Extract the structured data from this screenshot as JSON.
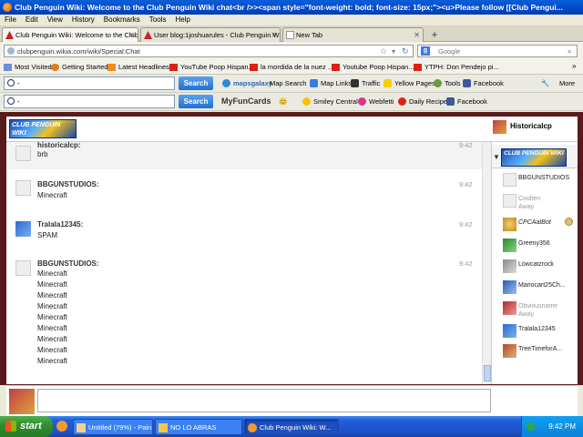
{
  "window": {
    "title": "Club Penguin Wiki: Welcome to the Club Penguin Wiki chat<br />><span style=\"font-weight: bold; font-size: 15px;\"><u>Please follow [[Club Pengui..."
  },
  "menu": [
    "File",
    "Edit",
    "View",
    "History",
    "Bookmarks",
    "Tools",
    "Help"
  ],
  "tabs": [
    {
      "label": "Club Penguin Wiki: Welcome to the Club ...",
      "active": true
    },
    {
      "label": "User blog:1joshuarules - Club Penguin Wi...",
      "active": false
    },
    {
      "label": "New Tab",
      "active": false
    }
  ],
  "nav": {
    "url": "clubpenguin.wikia.com/wiki/Special:Chat",
    "search_placeholder": "Google"
  },
  "bookmarks": [
    "Most Visited",
    "Getting Started",
    "Latest Headlines",
    "YouTube Poop Hispan...",
    "la mordida de la nuez ...",
    "Youtube Poop Hispan...",
    "YTPH: Don Pendejo pi..."
  ],
  "toolbar1": {
    "search_value": "-",
    "search_label": "Search",
    "items": [
      "Map Search",
      "Map Links",
      "Traffic",
      "Yellow Pages",
      "Tools",
      "Facebook"
    ],
    "brand": "mapsgalaxy",
    "right": "More"
  },
  "toolbar2": {
    "search_value": "-",
    "search_label": "Search",
    "brand": "MyFunCards",
    "items": [
      "Smiley Central",
      "Webfetti",
      "Daily Recipe",
      "Facebook"
    ]
  },
  "chat": {
    "logo_text": "CLUB PENGUIN WIKI",
    "current_user": "Historicalcp",
    "messages": [
      {
        "user": "historicalcp:",
        "time": "9:42",
        "lines": [
          "brb"
        ]
      },
      {
        "user": "BBGUNSTUDIOS:",
        "time": "9:42",
        "lines": [
          "Minecraft"
        ]
      },
      {
        "user": "Tralala12345:",
        "time": "9:42",
        "lines": [
          "SPAM"
        ]
      },
      {
        "user": "BBGUNSTUDIOS:",
        "time": "9:42",
        "lines": [
          "Minecraft",
          "Minecraft",
          "Minecraft",
          "Minecraft",
          "Minecraft",
          "Minecraft",
          "Minecraft",
          "Minecraft",
          "Minecraft"
        ]
      }
    ],
    "users": [
      {
        "name": "BBGUNSTUDIOS",
        "status": ""
      },
      {
        "name": "Coolten",
        "status": "Away"
      },
      {
        "name": "CPCAatBot",
        "status": ""
      },
      {
        "name": "Greeny356",
        "status": ""
      },
      {
        "name": "Lowcatzrock",
        "status": ""
      },
      {
        "name": "Mariocart25Ch...",
        "status": ""
      },
      {
        "name": "Obviousname",
        "status": "Away"
      },
      {
        "name": "Tralala12345",
        "status": ""
      },
      {
        "name": "TreeTimeforA...",
        "status": ""
      }
    ]
  },
  "taskbar": {
    "start": "start",
    "tasks": [
      "Untitled (79%) - Pain...",
      "NO LO ABRAS",
      "Club Penguin Wiki: W..."
    ],
    "clock": "9:42 PM"
  }
}
